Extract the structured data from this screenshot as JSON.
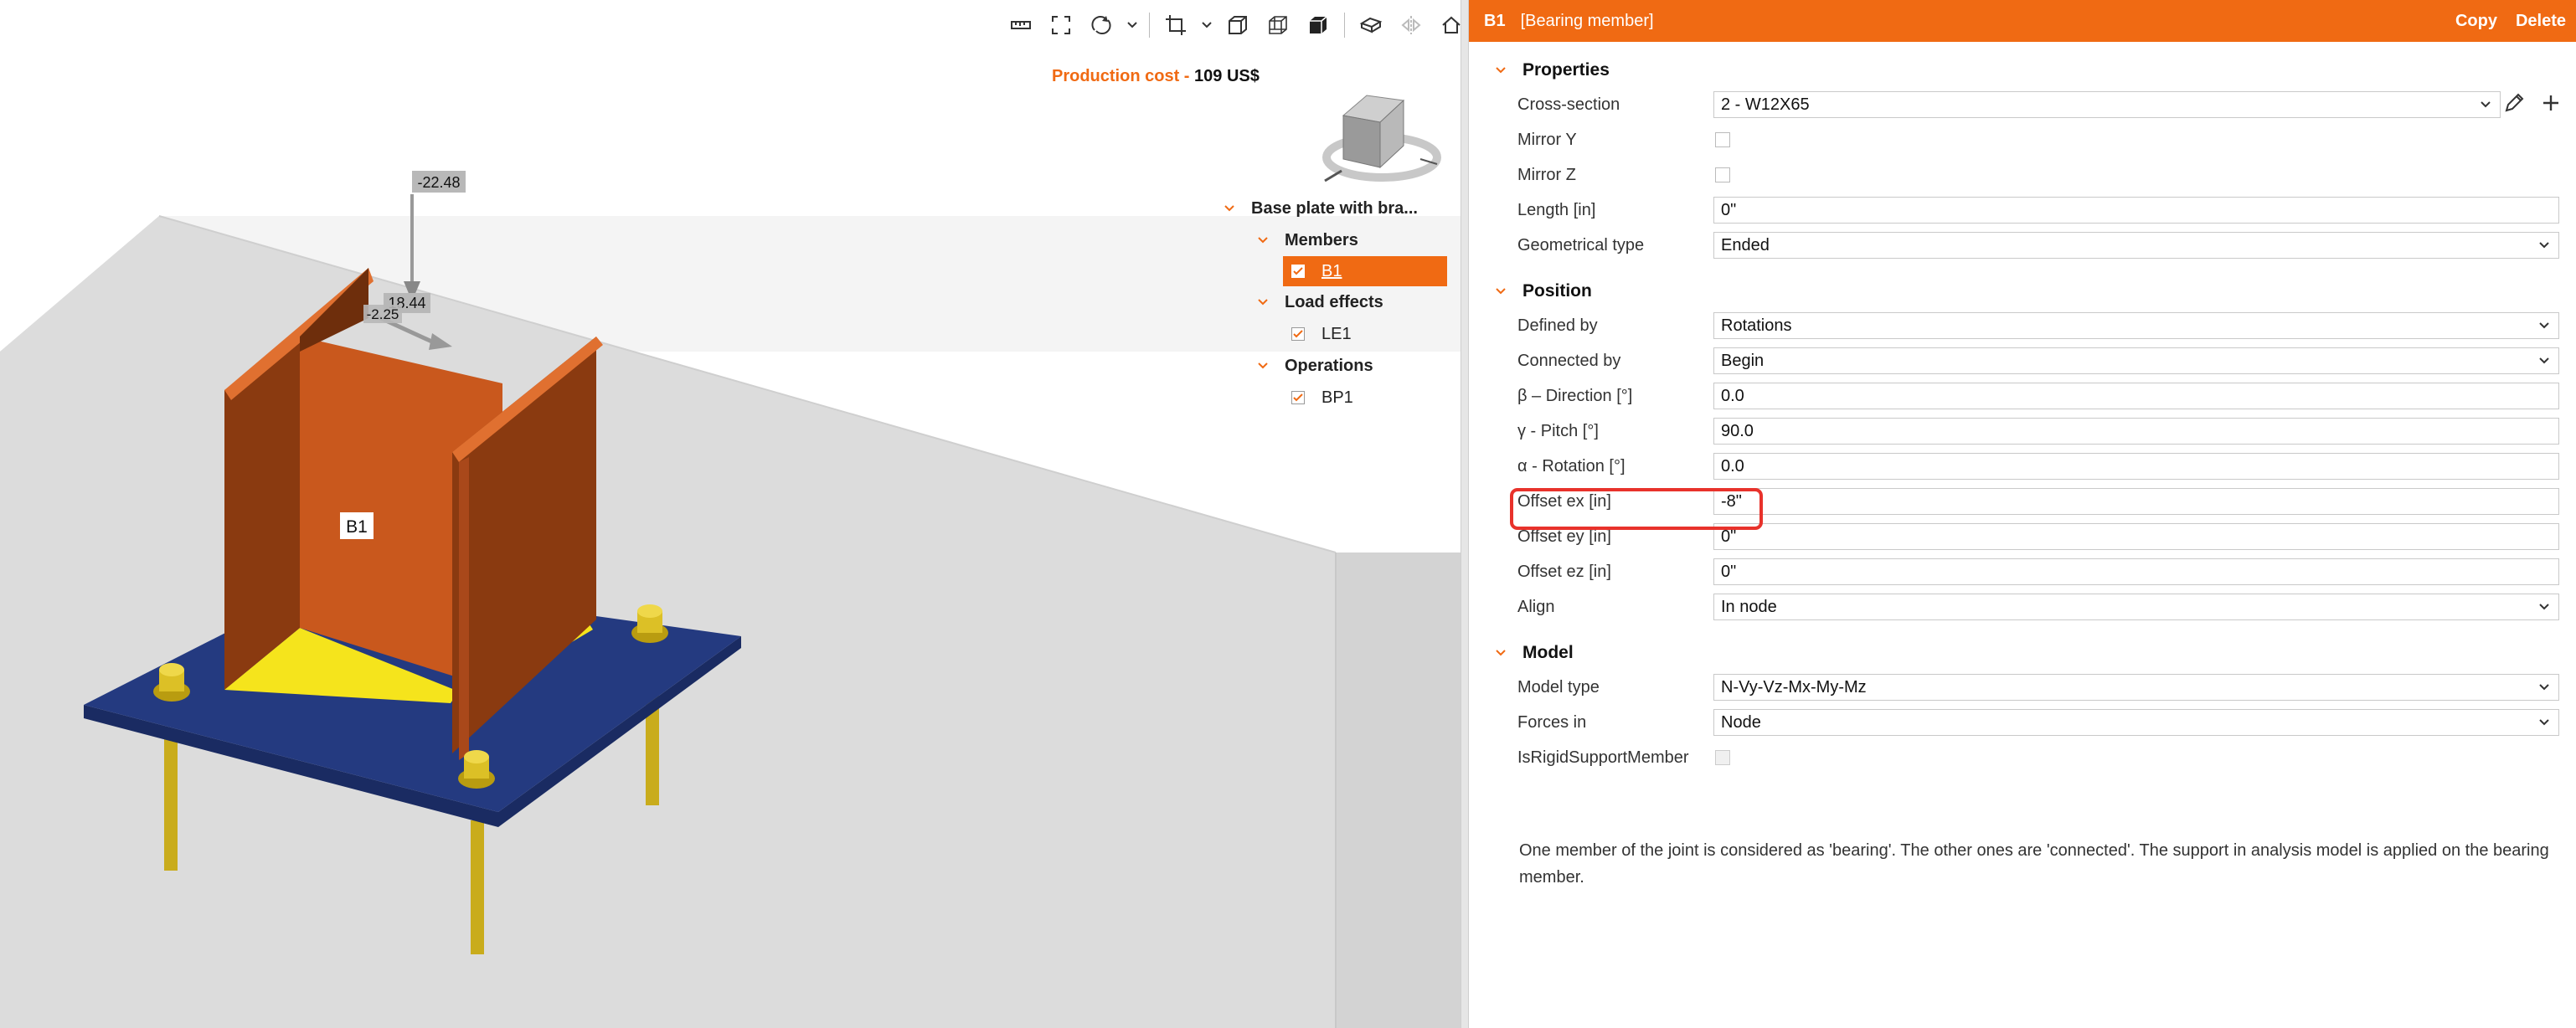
{
  "viewport": {
    "toolbar": {
      "icons": [
        "ruler-icon",
        "fit-view-icon",
        "rotate-icon",
        "chevron-down-icon",
        "crop-icon",
        "chevron-down-icon",
        "wireframe-cube-icon",
        "transparent-cube-icon",
        "solid-cube-icon",
        "section-plane-icon",
        "mirror-icon",
        "home-icon"
      ]
    },
    "production_cost": {
      "label": "Production cost",
      "separator": " - ",
      "value": "109 US$"
    },
    "scene": {
      "labels": {
        "member": "B1",
        "load_top": "-22.48",
        "load_mid": "18.44",
        "load_small": "-2.25"
      },
      "colors": {
        "member": "#c9581d",
        "plate": "#243a80",
        "weld": "#f5e41c",
        "anchor": "#c9ac1c",
        "floor": "#dcdcdc"
      }
    },
    "tree": {
      "root": "Base plate with bra...",
      "groups": [
        {
          "label": "Members",
          "items": [
            {
              "label": "B1",
              "checked": true,
              "selected": true
            }
          ]
        },
        {
          "label": "Load effects",
          "items": [
            {
              "label": "LE1",
              "checked": true,
              "selected": false
            }
          ]
        },
        {
          "label": "Operations",
          "items": [
            {
              "label": "BP1",
              "checked": true,
              "selected": false
            }
          ]
        }
      ]
    }
  },
  "properties": {
    "header": {
      "id": "B1",
      "type": "[Bearing member]",
      "copy": "Copy",
      "delete": "Delete"
    },
    "sections": {
      "properties": {
        "title": "Properties",
        "cross_section": {
          "label": "Cross-section",
          "value": "2 - W12X65"
        },
        "mirror_y": {
          "label": "Mirror Y",
          "checked": false
        },
        "mirror_z": {
          "label": "Mirror Z",
          "checked": false
        },
        "length": {
          "label": "Length [in]",
          "value": "0\""
        },
        "geometrical_type": {
          "label": "Geometrical type",
          "value": "Ended"
        }
      },
      "position": {
        "title": "Position",
        "defined_by": {
          "label": "Defined by",
          "value": "Rotations"
        },
        "connected_by": {
          "label": "Connected by",
          "value": "Begin"
        },
        "beta": {
          "label": "β – Direction [°]",
          "value": "0.0"
        },
        "gamma": {
          "label": "γ - Pitch [°]",
          "value": "90.0"
        },
        "alpha": {
          "label": "α - Rotation [°]",
          "value": "0.0"
        },
        "offset_ex": {
          "label": "Offset ex [in]",
          "value": "-8\""
        },
        "offset_ey": {
          "label": "Offset ey [in]",
          "value": "0\""
        },
        "offset_ez": {
          "label": "Offset ez [in]",
          "value": "0\""
        },
        "align": {
          "label": "Align",
          "value": "In node"
        }
      },
      "model": {
        "title": "Model",
        "model_type": {
          "label": "Model type",
          "value": "N-Vy-Vz-Mx-My-Mz"
        },
        "forces_in": {
          "label": "Forces in",
          "value": "Node"
        },
        "is_rigid": {
          "label": "IsRigidSupportMember",
          "checked": false
        }
      }
    },
    "note": "One member of the joint is considered as 'bearing'. The other ones are 'connected'. The support in analysis model is applied on the bearing member.",
    "accent_color": "#f06a13",
    "highlight_color": "#e8322b"
  }
}
